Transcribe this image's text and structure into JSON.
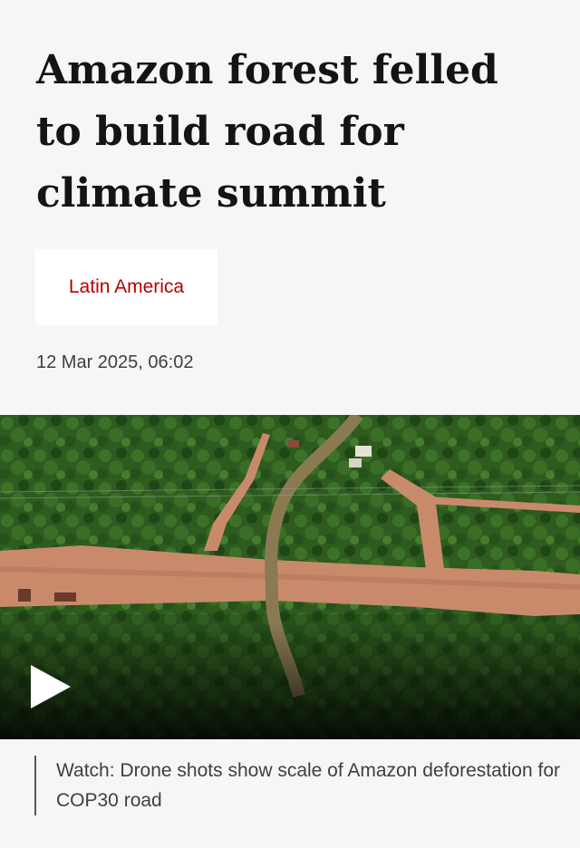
{
  "article": {
    "headline": "Amazon forest felled to build road for climate summit",
    "topic": "Latin America",
    "timestamp": "12 Mar 2025, 06:02"
  },
  "video": {
    "caption": "Watch: Drone shots show scale of Amazon deforestation for COP30 road"
  },
  "colors": {
    "page_background": "#f6f6f6",
    "topic_red": "#b80000",
    "forest_green": "#2f5a1f",
    "cleared_soil": "#c98a6c",
    "river_brown": "#8a7a52"
  },
  "icons": {
    "play": "play-icon"
  }
}
